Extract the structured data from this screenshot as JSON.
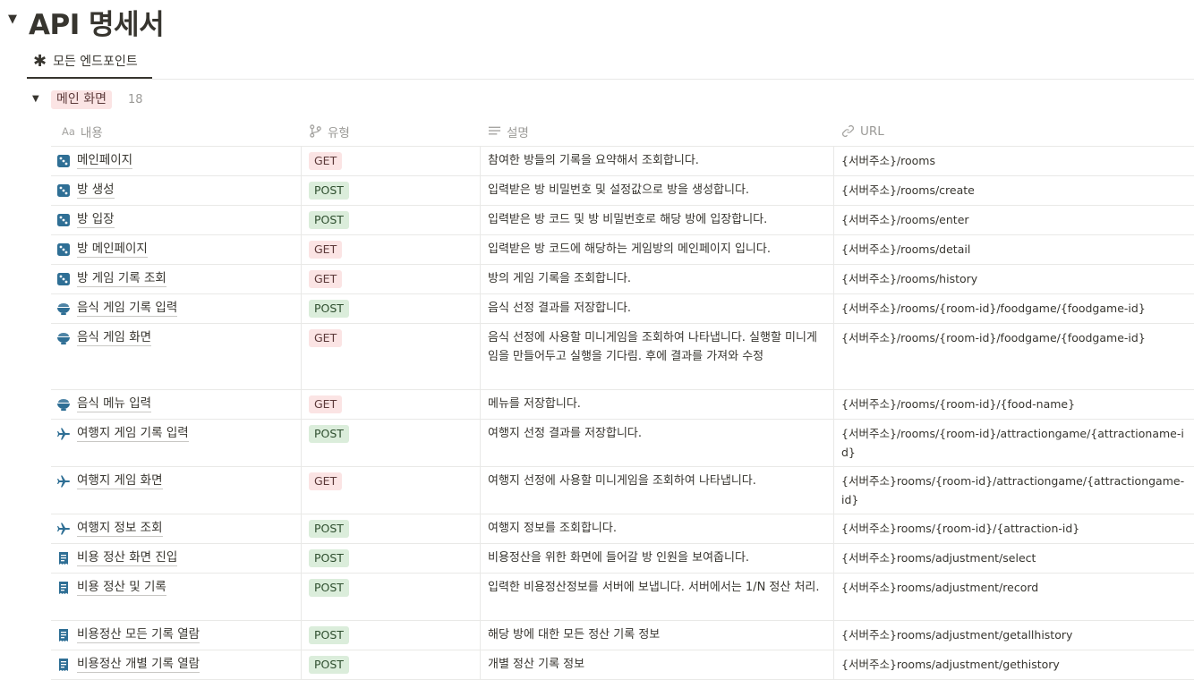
{
  "page": {
    "title": "API 명세서"
  },
  "view": {
    "tab_label": "모든 엔드포인트"
  },
  "group": {
    "label": "메인 화면",
    "count": "18"
  },
  "columns": {
    "name": "내용",
    "name_icon": "Aa",
    "type": "유형",
    "desc": "설명",
    "url": "URL"
  },
  "colors": {
    "get_badge": "#fbe4e4",
    "post_badge": "#dbeddb",
    "icon_blue": "#2f6f95"
  },
  "rows": [
    {
      "icon": "dice-icon",
      "name": "메인페이지",
      "type": "GET",
      "desc": "참여한 방들의 기록을 요약해서 조회합니다.",
      "url": "{서버주소}/rooms"
    },
    {
      "icon": "dice-icon",
      "name": "방 생성",
      "type": "POST",
      "desc": "입력받은 방 비밀번호 및 설정값으로 방을 생성합니다.",
      "url": "{서버주소}/rooms/create"
    },
    {
      "icon": "dice-icon",
      "name": "방 입장",
      "type": "POST",
      "desc": "입력받은 방 코드 및 방 비밀번호로 해당 방에 입장합니다.",
      "url": "{서버주소}/rooms/enter"
    },
    {
      "icon": "dice-icon",
      "name": "방 메인페이지",
      "type": "GET",
      "desc": "입력받은 방 코드에 해당하는 게임방의 메인페이지 입니다.",
      "url": "{서버주소}/rooms/detail"
    },
    {
      "icon": "dice-icon",
      "name": "방 게임 기록 조회",
      "type": "GET",
      "desc": "방의 게임 기록을 조회합니다.",
      "url": "{서버주소}/rooms/history"
    },
    {
      "icon": "bowl-icon",
      "name": "음식 게임 기록 입력",
      "type": "POST",
      "desc": "음식 선정 결과를 저장합니다.",
      "url": "{서버주소}/rooms/{room-id}/foodgame/{foodgame-id}"
    },
    {
      "icon": "bowl-icon",
      "name": "음식 게임 화면",
      "type": "GET",
      "desc": "음식 선정에 사용할 미니게임을 조회하여 나타냅니다. 실행할 미니게임을 만들어두고 실행을 기다림. 후에 결과를 가져와 수정",
      "url": "{서버주소}/rooms/{room-id}/foodgame/{foodgame-id}"
    },
    {
      "icon": "bowl-icon",
      "name": "음식 메뉴 입력",
      "type": "GET",
      "desc": "메뉴를 저장합니다.",
      "url": "{서버주소}/rooms/{room-id}/{food-name}"
    },
    {
      "icon": "airplane-icon",
      "name": "여행지 게임 기록 입력",
      "type": "POST",
      "desc": "여행지 선정 결과를 저장합니다.",
      "url": "{서버주소}/rooms/{room-id}/attractiongame/{attractioname-id}"
    },
    {
      "icon": "airplane-icon",
      "name": "여행지 게임 화면",
      "type": "GET",
      "desc": "여행지 선정에 사용할 미니게임을 조회하여 나타냅니다.",
      "url": "{서버주소}rooms/{room-id}/attractiongame/{attractiongame-id}"
    },
    {
      "icon": "airplane-icon",
      "name": "여행지 정보 조회",
      "type": "POST",
      "desc": "여행지 정보를 조회합니다.",
      "url": "{서버주소}rooms/{room-id}/{attraction-id}"
    },
    {
      "icon": "receipt-icon",
      "name": "비용 정산 화면 진입",
      "type": "POST",
      "desc": "비용정산을 위한 화면에 들어갈 방 인원을 보여줍니다.",
      "url": "{서버주소}rooms/adjustment/select"
    },
    {
      "icon": "receipt-icon",
      "name": "비용 정산 및 기록",
      "type": "POST",
      "desc": "입력한 비용정산정보를 서버에 보냅니다. 서버에서는 1/N 정산 처리.",
      "url": "{서버주소}rooms/adjustment/record"
    },
    {
      "icon": "receipt-icon",
      "name": "비용정산 모든 기록 열람",
      "type": "POST",
      "desc": "해당 방에 대한 모든 정산 기록 정보",
      "url": "{서버주소}rooms/adjustment/getallhistory"
    },
    {
      "icon": "receipt-icon",
      "name": "비용정산 개별 기록 열람",
      "type": "POST",
      "desc": "개별 정산 기록 정보",
      "url": "{서버주소}rooms/adjustment/gethistory"
    }
  ]
}
